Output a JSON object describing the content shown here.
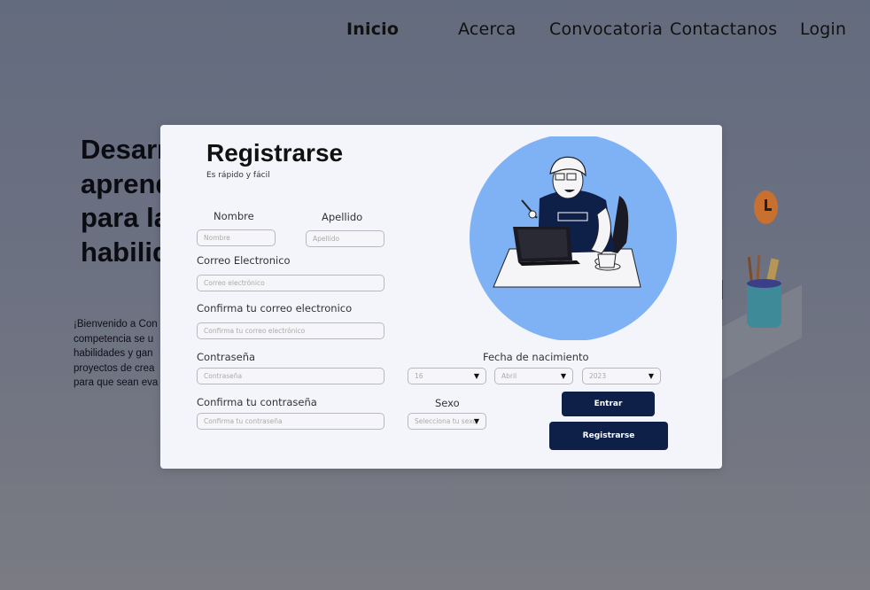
{
  "nav": {
    "home": "Inicio",
    "about": "Acerca",
    "calls": "Convocatoria",
    "contact": "Contactanos",
    "login": "Login"
  },
  "hero": {
    "title_lines": [
      "Desarrolla",
      "aprende",
      "para la",
      "habilidades"
    ],
    "text_lines": [
      "¡Bienvenido a Con",
      "competencia se u",
      "habilidades y gan",
      "proyectos de crea",
      "para que sean eva"
    ]
  },
  "modal": {
    "title": "Registrarse",
    "subtitle": "Es rápido y fácil",
    "first_name": {
      "label": "Nombre",
      "placeholder": "Nombre"
    },
    "last_name": {
      "label": "Apellido",
      "placeholder": "Apellido"
    },
    "email": {
      "label": "Correo Electronico",
      "placeholder": "Correo electrónico"
    },
    "email_confirm": {
      "label": "Confirma tu correo electronico",
      "placeholder": "Confirma tu correo electrónico"
    },
    "password": {
      "label": "Contraseña",
      "placeholder": "Contraseña"
    },
    "password_confirm": {
      "label": "Confirma tu contraseña",
      "placeholder": "Confirma tu contraseña"
    },
    "birthdate": {
      "label": "Fecha de nacimiento",
      "day": "16",
      "month": "Abril",
      "year": "2023"
    },
    "sex": {
      "label": "Sexo",
      "placeholder": "Selecciona tu sexo"
    },
    "enter_button": "Entrar",
    "register_button": "Registrarse"
  },
  "colors": {
    "primary_button": "#0e1f48",
    "illustration_circle": "#7fb2f5",
    "modal_bg": "#f4f5fb"
  }
}
